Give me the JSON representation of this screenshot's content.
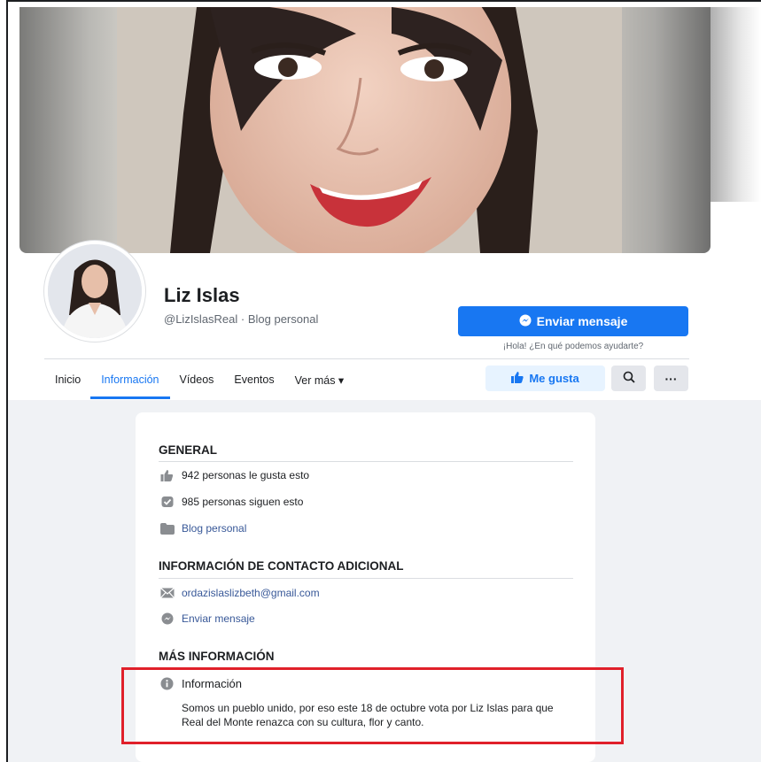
{
  "profile": {
    "name": "Liz Islas",
    "handle": "@LizIslasReal · Blog personal"
  },
  "actions": {
    "send_message": "Enviar mensaje",
    "help_text": "¡Hola! ¿En qué podemos ayudarte?",
    "like": "Me gusta",
    "more": "···"
  },
  "tabs": [
    {
      "label": "Inicio"
    },
    {
      "label": "Información"
    },
    {
      "label": "Vídeos"
    },
    {
      "label": "Eventos"
    },
    {
      "label": "Ver más ▾"
    }
  ],
  "general": {
    "title": "GENERAL",
    "likes": "942 personas le gusta esto",
    "followers": "985 personas siguen esto",
    "category": "Blog personal"
  },
  "contact": {
    "title": "INFORMACIÓN DE CONTACTO ADICIONAL",
    "email": "ordazislaslizbeth@gmail.com",
    "message": "Enviar mensaje"
  },
  "more_info": {
    "title": "MÁS INFORMACIÓN",
    "label": "Información",
    "description": "Somos un pueblo unido, por eso este 18 de octubre vota por Liz Islas para que Real del Monte renazca con su cultura, flor y canto."
  },
  "colors": {
    "accent": "#1877f2",
    "highlight": "#e0202a"
  }
}
